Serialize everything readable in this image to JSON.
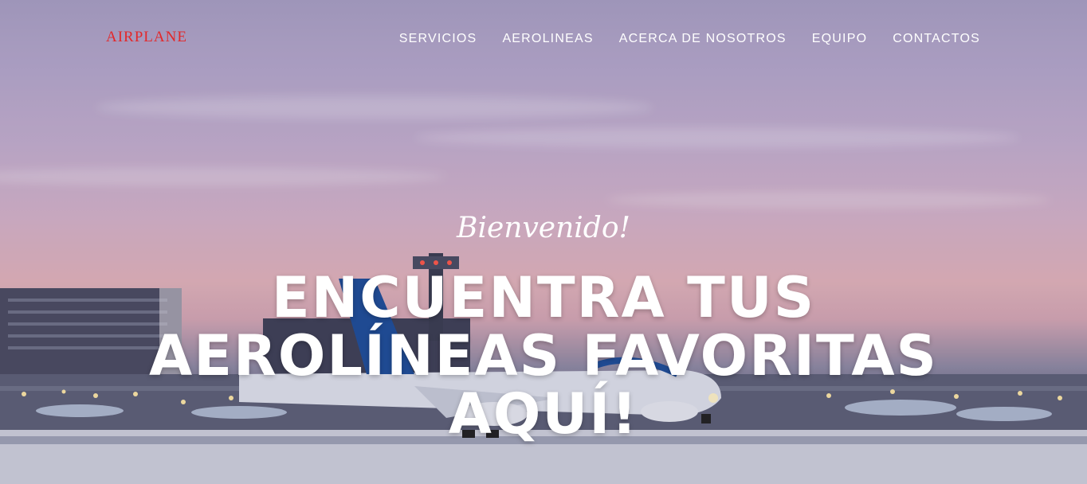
{
  "brand": {
    "name": "AIRPLANE",
    "color": "#e3282a"
  },
  "nav": {
    "items": [
      {
        "label": "SERVICIOS"
      },
      {
        "label": "AEROLINEAS"
      },
      {
        "label": "ACERCA DE NOSOTROS"
      },
      {
        "label": "EQUIPO"
      },
      {
        "label": "CONTACTOS"
      }
    ]
  },
  "hero": {
    "subheading": "Bienvenido!",
    "heading_lines": [
      "ENCUENTRA TUS",
      "AEROLÍNEAS FAVORITAS",
      "AQUÍ!"
    ],
    "background_description_icon": "airport-sunset-image"
  }
}
